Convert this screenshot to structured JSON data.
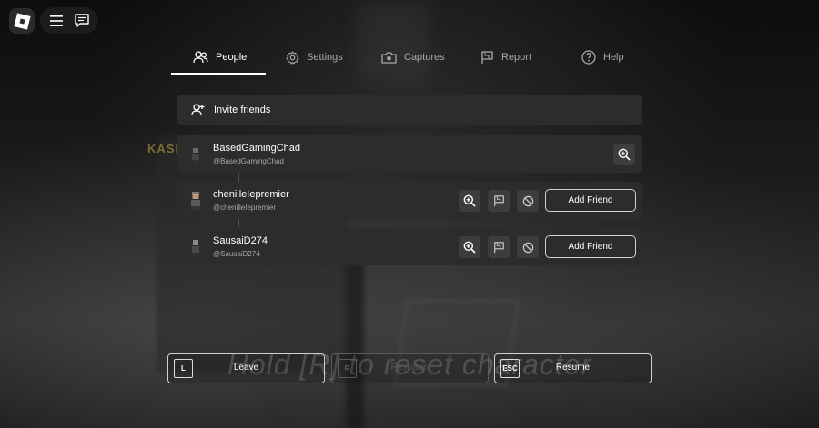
{
  "background": {
    "scene_text": "KASH",
    "hint_text": "Hold [R] to reset character"
  },
  "topbar": {
    "logo_icon": "roblox-logo",
    "menu_icon": "hamburger-menu-icon",
    "chat_icon": "chat-icon"
  },
  "tabs": [
    {
      "label": "People",
      "icon": "people-icon",
      "active": true
    },
    {
      "label": "Settings",
      "icon": "gear-icon",
      "active": false
    },
    {
      "label": "Captures",
      "icon": "camera-icon",
      "active": false
    },
    {
      "label": "Report",
      "icon": "flag-icon",
      "active": false
    },
    {
      "label": "Help",
      "icon": "help-icon",
      "active": false
    }
  ],
  "invite": {
    "label": "Invite friends",
    "icon": "add-friend-icon"
  },
  "players": [
    {
      "display_name": "BasedGamingChad",
      "username": "@BasedGamingChad",
      "is_self": true
    },
    {
      "display_name": "chenilleIepremier",
      "username": "@chenilleIepremier",
      "add_friend_label": "Add Friend"
    },
    {
      "display_name": "SausaiD274",
      "username": "@SausaiD274",
      "add_friend_label": "Add Friend"
    }
  ],
  "bottom_buttons": [
    {
      "key": "L",
      "label": "Leave"
    },
    {
      "key": "R",
      "label": "Respawn",
      "disabled": true
    },
    {
      "key": "ESC",
      "label": "Resume"
    }
  ],
  "colors": {
    "panel": "#2c2c2c",
    "icon_button": "#3d3d3d",
    "text": "#ffffff",
    "muted_text": "#a8a8a8"
  }
}
